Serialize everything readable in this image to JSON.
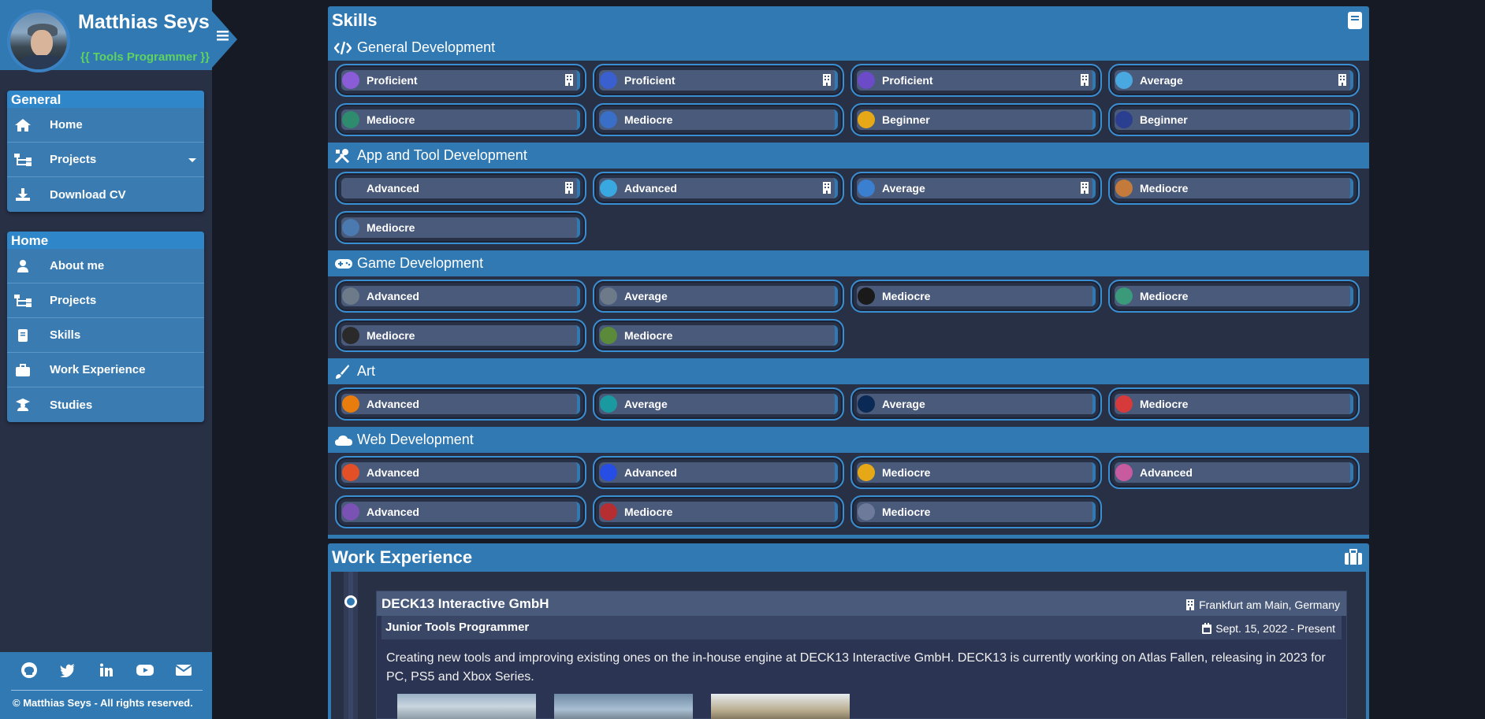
{
  "profile": {
    "name": "Matthias Seys",
    "role": "{{ Tools Programmer }}"
  },
  "nav_general": {
    "title": "General",
    "items": [
      {
        "label": "Home",
        "icon": "home-icon"
      },
      {
        "label": "Projects",
        "icon": "sitemap-icon"
      },
      {
        "label": "Download CV",
        "icon": "download-icon"
      }
    ]
  },
  "nav_home": {
    "title": "Home",
    "items": [
      {
        "label": "About me",
        "icon": "user-icon"
      },
      {
        "label": "Projects",
        "icon": "sitemap-icon"
      },
      {
        "label": "Skills",
        "icon": "book-icon"
      },
      {
        "label": "Work Experience",
        "icon": "briefcase-icon"
      },
      {
        "label": "Studies",
        "icon": "graduate-icon"
      }
    ]
  },
  "footer": {
    "social": [
      "github-icon",
      "twitter-icon",
      "linkedin-icon",
      "youtube-icon",
      "envelope-icon"
    ],
    "copyright": "© Matthias Seys - All rights reserved."
  },
  "skills": {
    "title": "Skills",
    "categories": [
      {
        "title": "General Development",
        "icon": "code-icon",
        "items": [
          {
            "level": "Proficient",
            "logo": "visual-studio-logo",
            "color": "#8a5cd8",
            "work": true
          },
          {
            "level": "Proficient",
            "logo": "csharp-logo",
            "color": "#3a5fcf",
            "work": true
          },
          {
            "level": "Proficient",
            "logo": "cpp-logo",
            "color": "#6b4bc7",
            "work": true
          },
          {
            "level": "Average",
            "logo": "python-logo",
            "color": "#4aa8e0",
            "work": true
          },
          {
            "level": "Mediocre",
            "logo": "unknown-logo",
            "color": "#2e8b6e",
            "work": false
          },
          {
            "level": "Mediocre",
            "logo": "sql-logo",
            "color": "#3a6fc7",
            "work": false
          },
          {
            "level": "Beginner",
            "logo": "rust-logo",
            "color": "#e6a817",
            "work": false
          },
          {
            "level": "Beginner",
            "logo": "assembly-logo",
            "color": "#2a3f8f",
            "work": false
          }
        ]
      },
      {
        "title": "App and Tool Development",
        "icon": "tools-icon",
        "items": [
          {
            "level": "Advanced",
            "logo": "dear-imgui-logo",
            "color": "#4a5a7a",
            "work": true
          },
          {
            "level": "Advanced",
            "logo": "qt-logo",
            "color": "#3aa8e0",
            "work": true
          },
          {
            "level": "Average",
            "logo": "wxwidgets-logo",
            "color": "#3a7fd0",
            "work": true
          },
          {
            "level": "Mediocre",
            "logo": "sfml-logo",
            "color": "#c47a3a",
            "work": false
          },
          {
            "level": "Mediocre",
            "logo": "cmake-logo",
            "color": "#4a7ab0",
            "work": false
          }
        ]
      },
      {
        "title": "Game Development",
        "icon": "gamepad-icon",
        "items": [
          {
            "level": "Advanced",
            "logo": "opengl-logo",
            "color": "#6d7a8a",
            "work": false
          },
          {
            "level": "Average",
            "logo": "unity-logo",
            "color": "#6d7a8a",
            "work": false
          },
          {
            "level": "Mediocre",
            "logo": "unreal-logo",
            "color": "#1a1a1a",
            "work": false
          },
          {
            "level": "Mediocre",
            "logo": "fmod-logo",
            "color": "#3a9a7a",
            "work": false
          },
          {
            "level": "Mediocre",
            "logo": "directx-logo",
            "color": "#2a2a2a",
            "work": false
          },
          {
            "level": "Mediocre",
            "logo": "physx-logo",
            "color": "#5a8a3a",
            "work": false
          }
        ]
      },
      {
        "title": "Art",
        "icon": "brush-icon",
        "items": [
          {
            "level": "Advanced",
            "logo": "blender-logo",
            "color": "#e87d0d",
            "work": false
          },
          {
            "level": "Average",
            "logo": "3ds-max-logo",
            "color": "#1a9aa0",
            "work": false
          },
          {
            "level": "Average",
            "logo": "photoshop-logo",
            "color": "#0a2a55",
            "work": false
          },
          {
            "level": "Mediocre",
            "logo": "substance-logo",
            "color": "#d63a3a",
            "work": false
          }
        ]
      },
      {
        "title": "Web Development",
        "icon": "cloud-icon",
        "items": [
          {
            "level": "Advanced",
            "logo": "html5-logo",
            "color": "#e34f26",
            "work": false
          },
          {
            "level": "Advanced",
            "logo": "css3-logo",
            "color": "#264de4",
            "work": false
          },
          {
            "level": "Mediocre",
            "logo": "javascript-logo",
            "color": "#e6a817",
            "work": false
          },
          {
            "level": "Advanced",
            "logo": "sass-logo",
            "color": "#c85aa0",
            "work": false
          },
          {
            "level": "Advanced",
            "logo": "bootstrap-logo",
            "color": "#7952b3",
            "work": false
          },
          {
            "level": "Mediocre",
            "logo": "angular-logo",
            "color": "#b52e31",
            "work": false
          },
          {
            "level": "Mediocre",
            "logo": "php-logo",
            "color": "#6d7a9a",
            "work": false
          }
        ]
      }
    ]
  },
  "work": {
    "title": "Work Experience",
    "company": "DECK13 Interactive GmbH",
    "location": "Frankfurt am Main, Germany",
    "role": "Junior Tools Programmer",
    "date": "Sept. 15, 2022 - Present",
    "description": "Creating new tools and improving existing ones on the in-house engine at DECK13 Interactive GmbH. DECK13 is currently working on Atlas Fallen, releasing in 2023 for PC, PS5 and Xbox Series."
  }
}
